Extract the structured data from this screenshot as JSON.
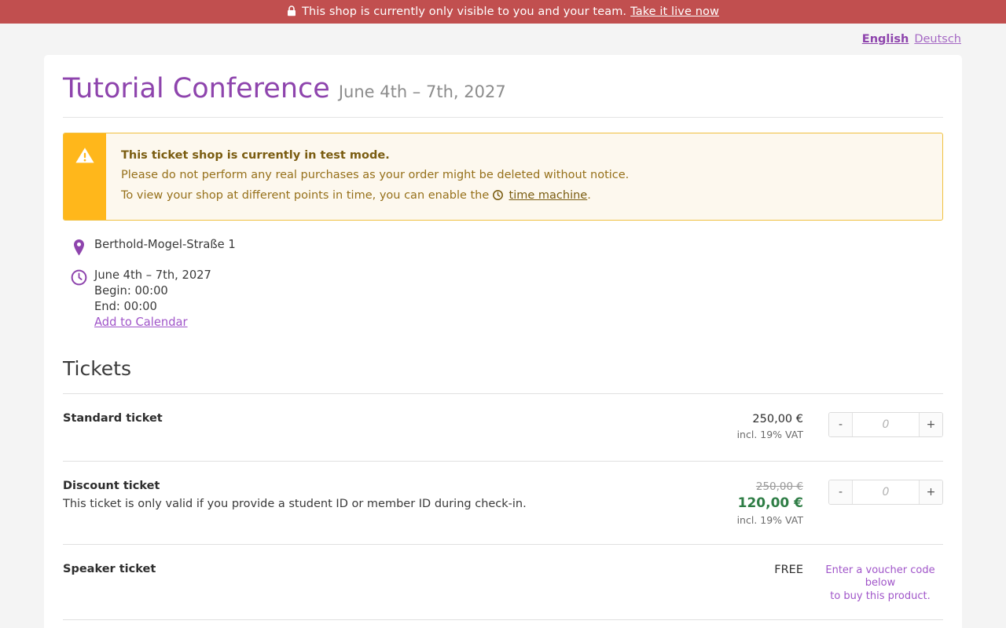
{
  "banner": {
    "icon": "lock-icon",
    "text": "This shop is currently only visible to you and your team.",
    "link_label": "Take it live now",
    "background_color": "#c14f4f"
  },
  "language_bar": {
    "active": "English",
    "other": "Deutsch",
    "active_color": "#8e44ad"
  },
  "header": {
    "title": "Tutorial Conference",
    "date_range": "June 4th – 7th, 2027",
    "title_color": "#8e44ad"
  },
  "alert": {
    "icon": "warning-triangle-icon",
    "title": "This ticket shop is currently in test mode.",
    "line2": "Please do not perform any real purchases as your order might be deleted without notice.",
    "line3_prefix": "To view your shop at different points in time, you can enable the",
    "link_icon": "clock-icon",
    "link_label": "time machine",
    "line3_suffix": ".",
    "accent_color": "#ffb71b",
    "background_color": "#fdf8ee"
  },
  "meta": {
    "location": {
      "icon": "map-marker-icon",
      "value": "Berthold-Mogel-Straße 1"
    },
    "time": {
      "icon": "clock-icon",
      "date_range": "June 4th – 7th, 2027",
      "begin": "Begin: 00:00",
      "end": "End: 00:00",
      "calendar_link": "Add to Calendar"
    }
  },
  "tickets": {
    "heading": "Tickets",
    "items": [
      {
        "name": "Standard ticket",
        "description": "",
        "price": "250,00 €",
        "original_price": "",
        "discount_price": "",
        "vat": "incl. 19% VAT",
        "has_quantity": true,
        "qty_minus": "-",
        "qty_plus": "+",
        "qty_placeholder": "0",
        "qty_value": "",
        "voucher_note_line1": "",
        "voucher_note_line2": ""
      },
      {
        "name": "Discount ticket",
        "description": "This ticket is only valid if you provide a student ID or member ID during check-in.",
        "price": "",
        "original_price": "250,00 €",
        "discount_price": "120,00 €",
        "vat": "incl. 19% VAT",
        "has_quantity": true,
        "qty_minus": "-",
        "qty_plus": "+",
        "qty_placeholder": "0",
        "qty_value": "",
        "voucher_note_line1": "",
        "voucher_note_line2": ""
      },
      {
        "name": "Speaker ticket",
        "description": "",
        "price": "FREE",
        "original_price": "",
        "discount_price": "",
        "vat": "",
        "has_quantity": false,
        "qty_minus": "",
        "qty_plus": "",
        "qty_placeholder": "",
        "qty_value": "",
        "voucher_note_line1": "Enter a voucher code below",
        "voucher_note_line2": "to buy this product."
      }
    ]
  }
}
